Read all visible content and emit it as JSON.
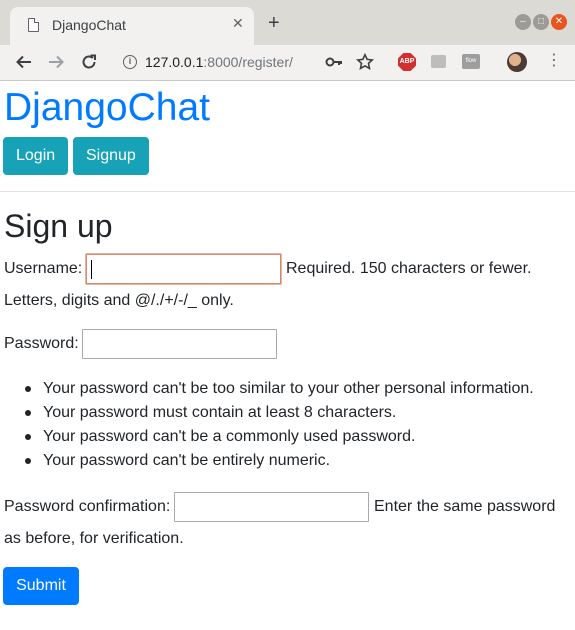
{
  "browser": {
    "tab_title": "DjangoChat",
    "tab_close": "✕",
    "new_tab": "+",
    "url_host": "127.0.0.1",
    "url_rest": ":8000/register/",
    "window_controls": [
      "–",
      "□",
      "✕"
    ],
    "extension_abp": "ABP",
    "extension_flow": "flow"
  },
  "navbar": {
    "brand": "DjangoChat",
    "login_label": "Login",
    "signup_label": "Signup"
  },
  "form": {
    "heading": "Sign up",
    "username_label": "Username:",
    "username_value": "",
    "username_help_1": "Required. 150 characters or fewer.",
    "username_help_2": "Letters, digits and @/./+/-/_ only.",
    "password_label": "Password:",
    "password_value": "",
    "password_rules": [
      "Your password can't be too similar to your other personal information.",
      "Your password must contain at least 8 characters.",
      "Your password can't be a commonly used password.",
      "Your password can't be entirely numeric."
    ],
    "confirm_label": "Password confirmation:",
    "confirm_value": "",
    "confirm_help_1": "Enter the same password",
    "confirm_help_2": "as before, for verification.",
    "submit_label": "Submit"
  },
  "colors": {
    "brand": "#007bff",
    "nav_button": "#17a2b8",
    "submit_button": "#007bff",
    "focus_border": "#d08a72"
  },
  "icons": [
    "page-icon",
    "back-arrow-icon",
    "forward-arrow-icon",
    "reload-icon",
    "info-icon",
    "key-icon",
    "star-icon",
    "abp-icon",
    "extension-icon",
    "flow-icon",
    "avatar",
    "kebab-menu-icon"
  ]
}
